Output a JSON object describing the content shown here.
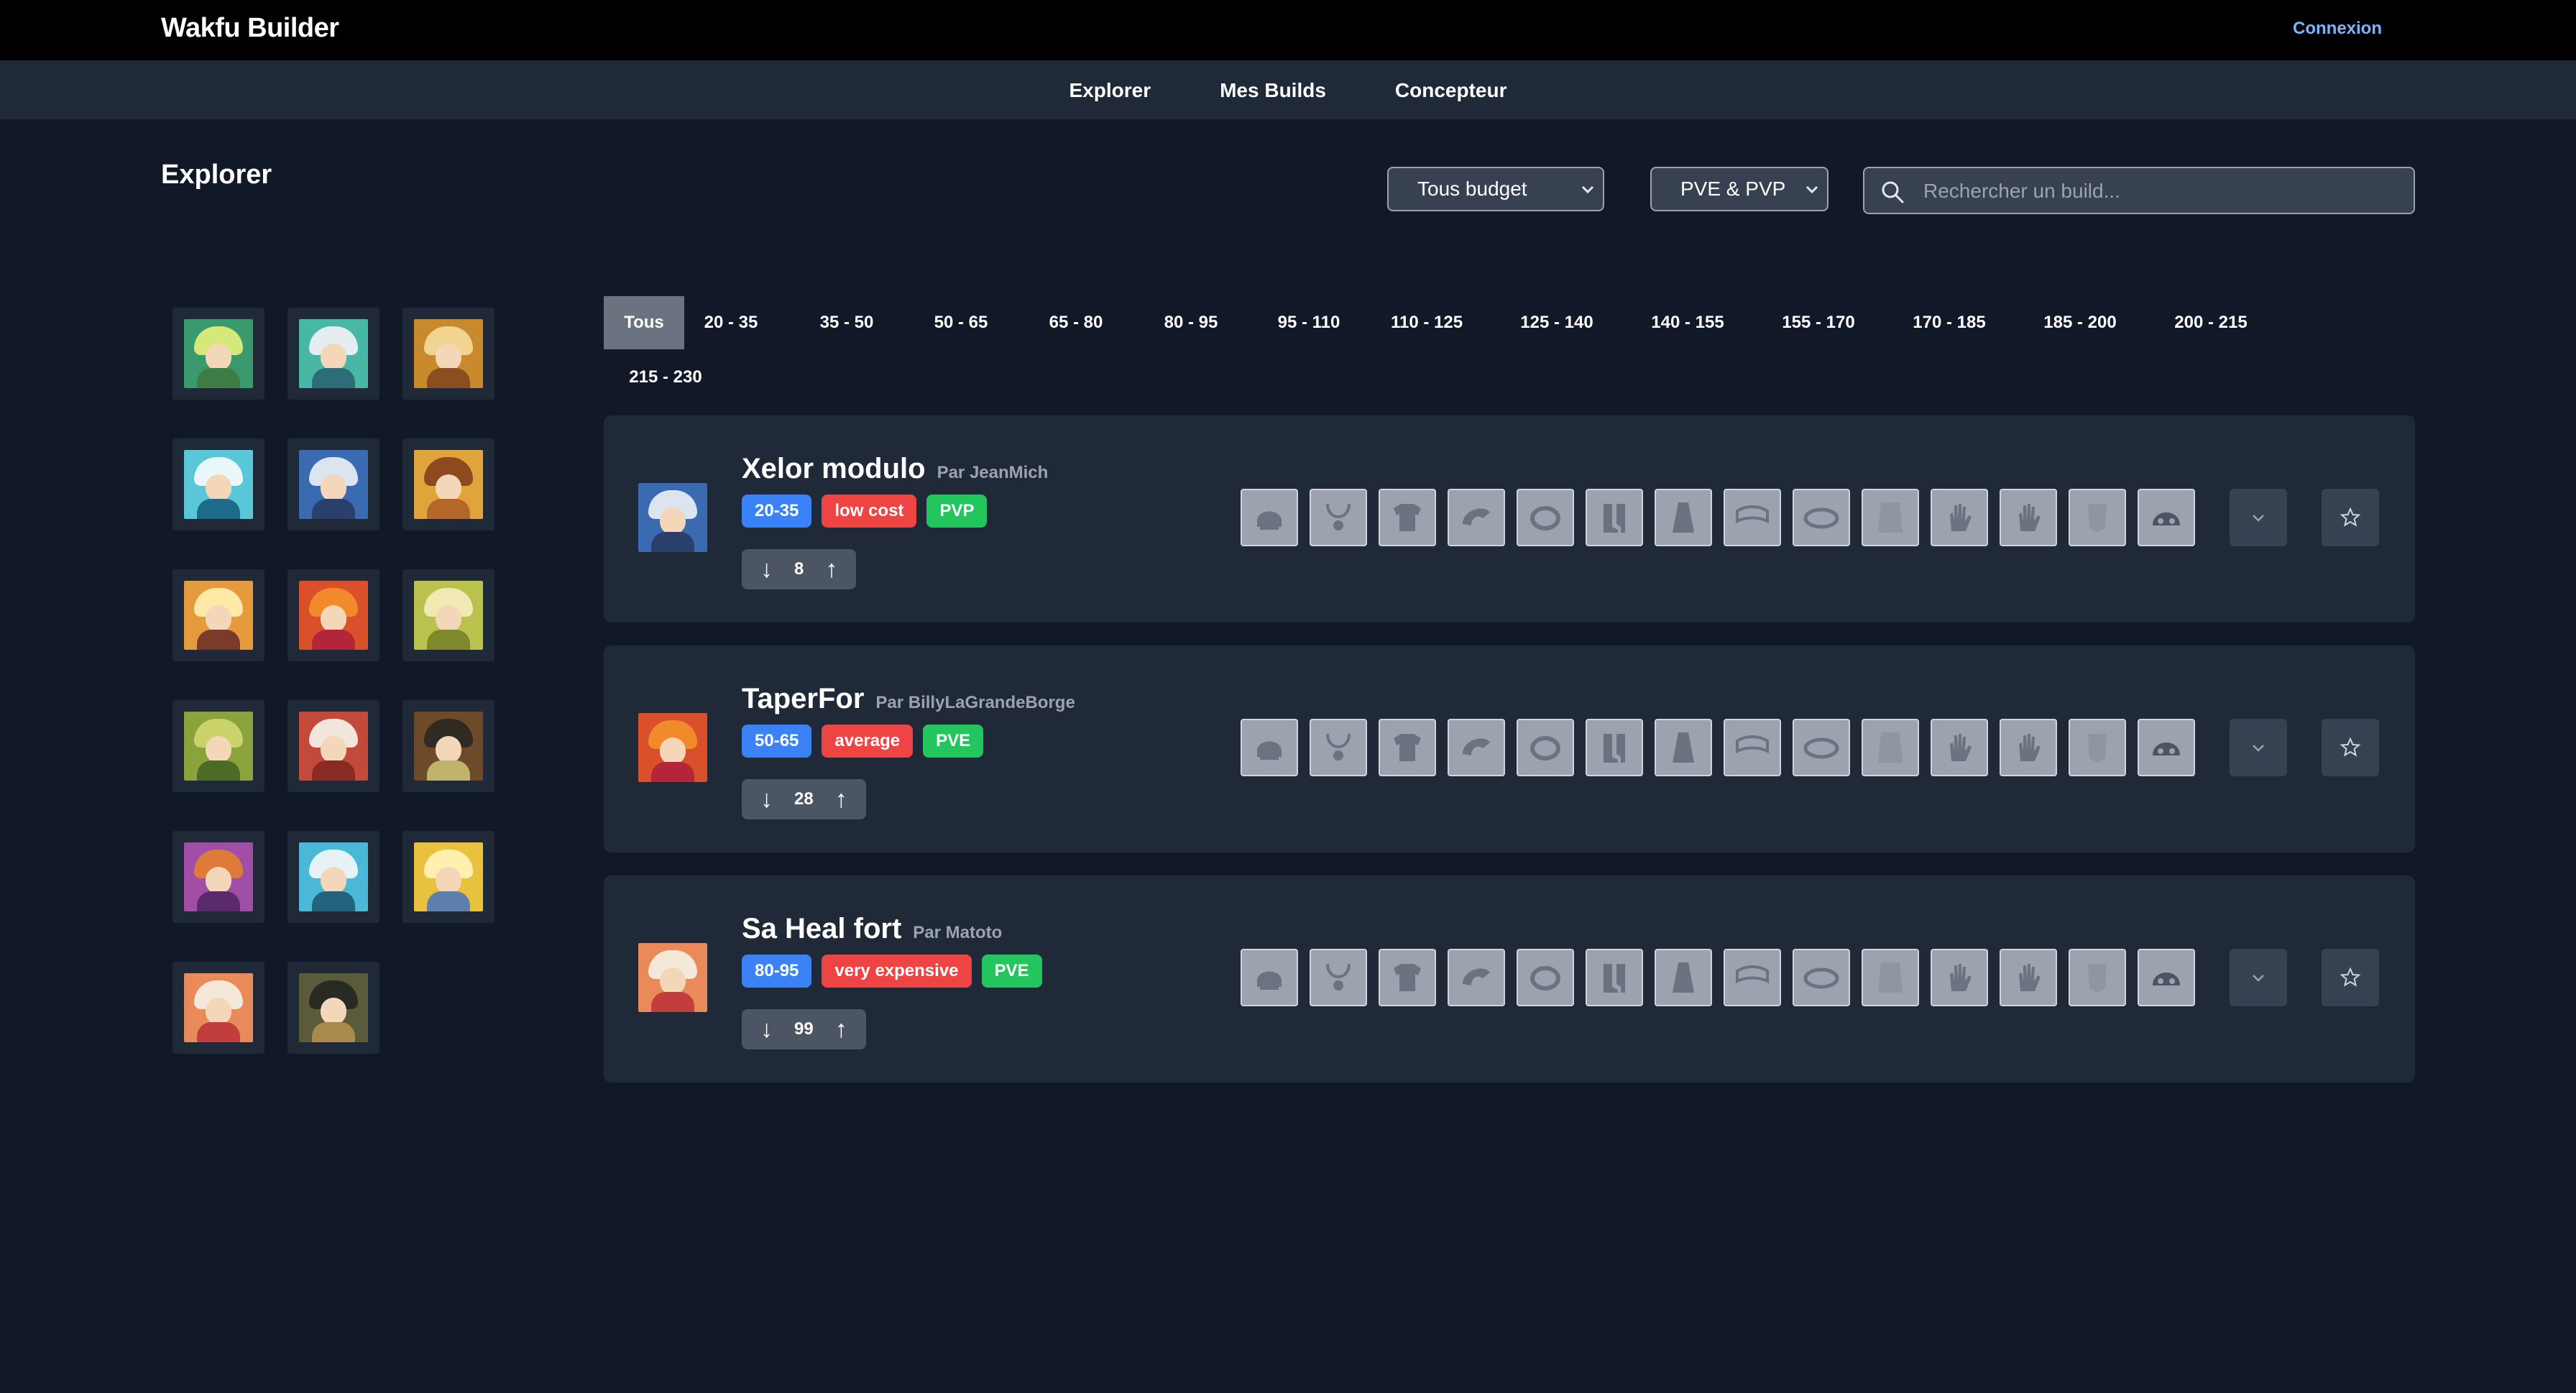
{
  "app": {
    "brand": "Wakfu Builder",
    "login_label": "Connexion"
  },
  "nav": {
    "items": [
      "Explorer",
      "Mes Builds",
      "Concepteur"
    ]
  },
  "page": {
    "title": "Explorer",
    "budget_filter": "Tous budget",
    "mode_filter": "PVE & PVP",
    "search_placeholder": "Rechercher un build..."
  },
  "colors": {
    "background": "#111827",
    "surface": "#1f2937",
    "link": "#7fb3ff",
    "level_badge": "#3b82f6",
    "budget_badge": "#ef4444",
    "mode_badge": "#22c55e",
    "active_tab": "#6b7280",
    "vote_box": "#4b5563",
    "slot": "#9ca3af"
  },
  "classes": [
    {
      "icon": "class-icon-1",
      "bg": "#3a9a6e",
      "hair": "#d5e87a",
      "body": "#3f7d47"
    },
    {
      "icon": "class-icon-2",
      "bg": "#48b7a6",
      "hair": "#e6edf0",
      "body": "#2c6d78"
    },
    {
      "icon": "class-icon-3",
      "bg": "#c98a2e",
      "hair": "#f1d492",
      "body": "#8a4f1f"
    },
    {
      "icon": "class-icon-4",
      "bg": "#5ac7d8",
      "hair": "#eaf6f7",
      "body": "#1e6a8c"
    },
    {
      "icon": "class-icon-5",
      "bg": "#3a6bb0",
      "hair": "#dce4ef",
      "body": "#2a3f6b"
    },
    {
      "icon": "class-icon-6",
      "bg": "#e0a43c",
      "hair": "#8c4a1e",
      "body": "#b5672a"
    },
    {
      "icon": "class-icon-7",
      "bg": "#e59b3d",
      "hair": "#ffe9a6",
      "body": "#7b3b2a"
    },
    {
      "icon": "class-icon-8",
      "bg": "#d9502a",
      "hair": "#f08a2b",
      "body": "#b3263a"
    },
    {
      "icon": "class-icon-9",
      "bg": "#b8c24c",
      "hair": "#f1e9b3",
      "body": "#7d8a2c"
    },
    {
      "icon": "class-icon-10",
      "bg": "#8ba33c",
      "hair": "#c9d36a",
      "body": "#4e6b25"
    },
    {
      "icon": "class-icon-11",
      "bg": "#c24a3a",
      "hair": "#f2e6dc",
      "body": "#8a2a24"
    },
    {
      "icon": "class-icon-12",
      "bg": "#6c4a2a",
      "hair": "#2f2a22",
      "body": "#c2b36a"
    },
    {
      "icon": "class-icon-13",
      "bg": "#a04ea6",
      "hair": "#e07a3a",
      "body": "#5a2a6a"
    },
    {
      "icon": "class-icon-14",
      "bg": "#4bb8d8",
      "hair": "#e7f2f7",
      "body": "#25627d"
    },
    {
      "icon": "class-icon-15",
      "bg": "#e8c23e",
      "hair": "#fff0b0",
      "body": "#5c7fb0"
    },
    {
      "icon": "class-icon-16",
      "bg": "#e88a5a",
      "hair": "#f4e8d8",
      "body": "#c23e3e"
    },
    {
      "icon": "class-icon-17",
      "bg": "#5b5a3a",
      "hair": "#2a2a24",
      "body": "#a88a4a"
    }
  ],
  "level_tabs": [
    "Tous",
    "20 - 35",
    "35 - 50",
    "50 - 65",
    "65 - 80",
    "80 - 95",
    "95 - 110",
    "110 - 125",
    "125 - 140",
    "140 - 155",
    "155 - 170",
    "170 - 185",
    "185 - 200",
    "200 - 215",
    "215 - 230"
  ],
  "active_tab": "Tous",
  "equipment_slots": [
    "helmet-icon",
    "amulet-icon",
    "chestplate-icon",
    "shoulder-icon",
    "ring-icon",
    "boots-icon",
    "cape-icon",
    "belt-icon",
    "epaulette-icon",
    "costume-icon",
    "hand-icon",
    "hand-icon",
    "emblem-icon",
    "pet-icon"
  ],
  "builds": [
    {
      "name": "Xelor modulo",
      "author": "Par JeanMich",
      "level": "20-35",
      "budget": "low cost",
      "mode": "PVP",
      "votes": "8",
      "portrait": {
        "bg": "#3a6bb0",
        "hair": "#dce4ef",
        "body": "#2a3f6b"
      }
    },
    {
      "name": "TaperFor",
      "author": "Par BillyLaGrandeBorge",
      "level": "50-65",
      "budget": "average",
      "mode": "PVE",
      "votes": "28",
      "portrait": {
        "bg": "#d9502a",
        "hair": "#f08a2b",
        "body": "#b3263a"
      }
    },
    {
      "name": "Sa Heal fort",
      "author": "Par Matoto",
      "level": "80-95",
      "budget": "very expensive",
      "mode": "PVE",
      "votes": "99",
      "portrait": {
        "bg": "#e88a5a",
        "hair": "#f4e8d8",
        "body": "#c23e3e"
      }
    }
  ]
}
